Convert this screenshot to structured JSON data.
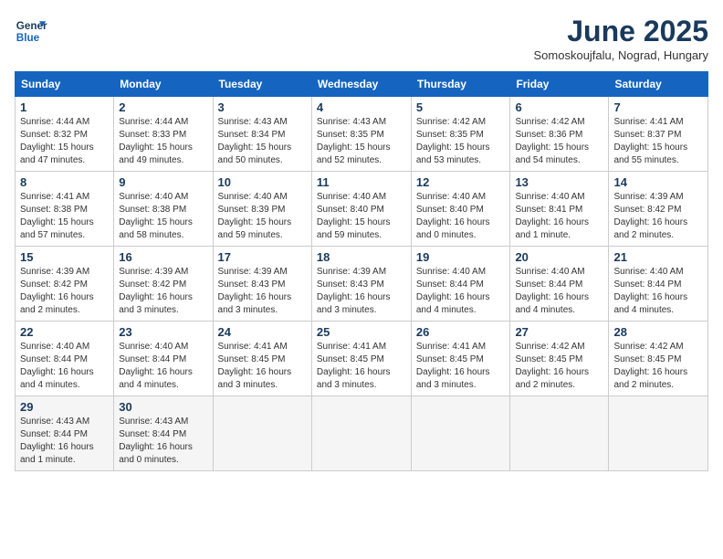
{
  "header": {
    "logo_line1": "General",
    "logo_line2": "Blue",
    "month": "June 2025",
    "location": "Somoskoujfalu, Nograd, Hungary"
  },
  "days_of_week": [
    "Sunday",
    "Monday",
    "Tuesday",
    "Wednesday",
    "Thursday",
    "Friday",
    "Saturday"
  ],
  "weeks": [
    [
      {
        "num": "1",
        "sunrise": "4:44 AM",
        "sunset": "8:32 PM",
        "daylight": "15 hours and 47 minutes."
      },
      {
        "num": "2",
        "sunrise": "4:44 AM",
        "sunset": "8:33 PM",
        "daylight": "15 hours and 49 minutes."
      },
      {
        "num": "3",
        "sunrise": "4:43 AM",
        "sunset": "8:34 PM",
        "daylight": "15 hours and 50 minutes."
      },
      {
        "num": "4",
        "sunrise": "4:43 AM",
        "sunset": "8:35 PM",
        "daylight": "15 hours and 52 minutes."
      },
      {
        "num": "5",
        "sunrise": "4:42 AM",
        "sunset": "8:35 PM",
        "daylight": "15 hours and 53 minutes."
      },
      {
        "num": "6",
        "sunrise": "4:42 AM",
        "sunset": "8:36 PM",
        "daylight": "15 hours and 54 minutes."
      },
      {
        "num": "7",
        "sunrise": "4:41 AM",
        "sunset": "8:37 PM",
        "daylight": "15 hours and 55 minutes."
      }
    ],
    [
      {
        "num": "8",
        "sunrise": "4:41 AM",
        "sunset": "8:38 PM",
        "daylight": "15 hours and 57 minutes."
      },
      {
        "num": "9",
        "sunrise": "4:40 AM",
        "sunset": "8:38 PM",
        "daylight": "15 hours and 58 minutes."
      },
      {
        "num": "10",
        "sunrise": "4:40 AM",
        "sunset": "8:39 PM",
        "daylight": "15 hours and 59 minutes."
      },
      {
        "num": "11",
        "sunrise": "4:40 AM",
        "sunset": "8:40 PM",
        "daylight": "15 hours and 59 minutes."
      },
      {
        "num": "12",
        "sunrise": "4:40 AM",
        "sunset": "8:40 PM",
        "daylight": "16 hours and 0 minutes."
      },
      {
        "num": "13",
        "sunrise": "4:40 AM",
        "sunset": "8:41 PM",
        "daylight": "16 hours and 1 minute."
      },
      {
        "num": "14",
        "sunrise": "4:39 AM",
        "sunset": "8:42 PM",
        "daylight": "16 hours and 2 minutes."
      }
    ],
    [
      {
        "num": "15",
        "sunrise": "4:39 AM",
        "sunset": "8:42 PM",
        "daylight": "16 hours and 2 minutes."
      },
      {
        "num": "16",
        "sunrise": "4:39 AM",
        "sunset": "8:42 PM",
        "daylight": "16 hours and 3 minutes."
      },
      {
        "num": "17",
        "sunrise": "4:39 AM",
        "sunset": "8:43 PM",
        "daylight": "16 hours and 3 minutes."
      },
      {
        "num": "18",
        "sunrise": "4:39 AM",
        "sunset": "8:43 PM",
        "daylight": "16 hours and 3 minutes."
      },
      {
        "num": "19",
        "sunrise": "4:40 AM",
        "sunset": "8:44 PM",
        "daylight": "16 hours and 4 minutes."
      },
      {
        "num": "20",
        "sunrise": "4:40 AM",
        "sunset": "8:44 PM",
        "daylight": "16 hours and 4 minutes."
      },
      {
        "num": "21",
        "sunrise": "4:40 AM",
        "sunset": "8:44 PM",
        "daylight": "16 hours and 4 minutes."
      }
    ],
    [
      {
        "num": "22",
        "sunrise": "4:40 AM",
        "sunset": "8:44 PM",
        "daylight": "16 hours and 4 minutes."
      },
      {
        "num": "23",
        "sunrise": "4:40 AM",
        "sunset": "8:44 PM",
        "daylight": "16 hours and 4 minutes."
      },
      {
        "num": "24",
        "sunrise": "4:41 AM",
        "sunset": "8:45 PM",
        "daylight": "16 hours and 3 minutes."
      },
      {
        "num": "25",
        "sunrise": "4:41 AM",
        "sunset": "8:45 PM",
        "daylight": "16 hours and 3 minutes."
      },
      {
        "num": "26",
        "sunrise": "4:41 AM",
        "sunset": "8:45 PM",
        "daylight": "16 hours and 3 minutes."
      },
      {
        "num": "27",
        "sunrise": "4:42 AM",
        "sunset": "8:45 PM",
        "daylight": "16 hours and 2 minutes."
      },
      {
        "num": "28",
        "sunrise": "4:42 AM",
        "sunset": "8:45 PM",
        "daylight": "16 hours and 2 minutes."
      }
    ],
    [
      {
        "num": "29",
        "sunrise": "4:43 AM",
        "sunset": "8:44 PM",
        "daylight": "16 hours and 1 minute."
      },
      {
        "num": "30",
        "sunrise": "4:43 AM",
        "sunset": "8:44 PM",
        "daylight": "16 hours and 0 minutes."
      },
      null,
      null,
      null,
      null,
      null
    ]
  ]
}
